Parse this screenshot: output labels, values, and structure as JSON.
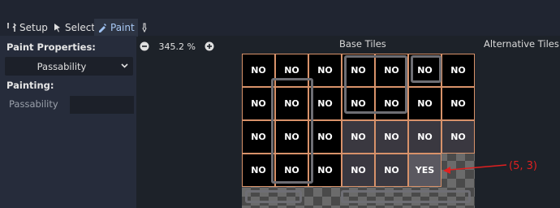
{
  "toolbar": {
    "setup_label": "Setup",
    "select_label": "Select",
    "paint_label": "Paint",
    "active_tab": "Paint"
  },
  "left_panel": {
    "paint_properties_heading": "Paint Properties:",
    "property_dropdown_value": "Passability",
    "painting_heading": "Painting:",
    "painting_field_label": "Passability"
  },
  "viewport": {
    "zoom_level": "345.2 %",
    "base_tiles_heading": "Base Tiles",
    "alternative_tiles_heading": "Alternative Tiles"
  },
  "grid": {
    "rows": [
      [
        "NO",
        "NO",
        "NO",
        "NO",
        "NO",
        "NO",
        "NO"
      ],
      [
        "NO",
        "NO",
        "NO",
        "NO",
        "NO",
        "NO",
        "NO"
      ],
      [
        "NO",
        "NO",
        "NO",
        "NO",
        "NO",
        "NO",
        "NO"
      ],
      [
        "NO",
        "NO",
        "NO",
        "NO",
        "NO",
        "YES",
        ""
      ]
    ],
    "highlight_color": "#d8926a"
  },
  "annotation": {
    "coordinate_label": "(5, 3)",
    "color": "#e02020"
  }
}
